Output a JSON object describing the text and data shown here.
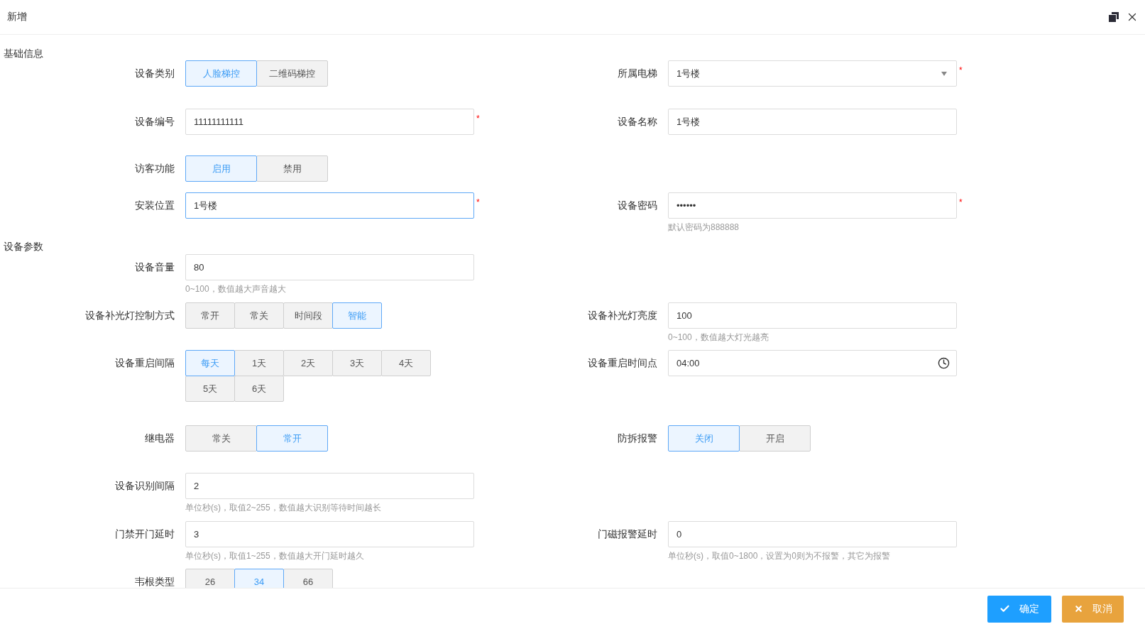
{
  "dialog": {
    "title": "新增"
  },
  "sections": [
    {
      "title": "基础信息",
      "rows": [
        {
          "left": {
            "label": "设备类别",
            "kind": "segmented",
            "options": [
              {
                "label": "人脸梯控",
                "selected": true
              },
              {
                "label": "二维码梯控",
                "selected": false
              }
            ]
          },
          "right": {
            "label": "所属电梯",
            "kind": "select",
            "value": "1号楼",
            "focused": false,
            "required_mark": "*"
          }
        },
        {
          "left": {
            "label": "设备编号",
            "kind": "input",
            "value": "11111111111",
            "focused": false,
            "required_mark": "*"
          },
          "right": {
            "label": "设备名称",
            "kind": "input",
            "value": "1号楼",
            "focused": false
          }
        },
        {
          "left": {
            "label": "访客功能",
            "kind": "segmented",
            "options": [
              {
                "label": "启用",
                "selected": true
              },
              {
                "label": "禁用",
                "selected": false
              }
            ]
          }
        },
        {
          "left": {
            "label": "安装位置",
            "kind": "input",
            "value": "1号楼",
            "focused": true,
            "required_mark": "*"
          },
          "right": {
            "label": "设备密码",
            "kind": "input",
            "value": "••••••",
            "focused": false,
            "required_mark": "*",
            "hint": "默认密码为888888"
          }
        }
      ]
    },
    {
      "title": "设备参数",
      "rows": [
        {
          "left": {
            "label": "设备音量",
            "kind": "input",
            "value": "80",
            "focused": false,
            "hint": "0~100，数值越大声音越大"
          }
        },
        {
          "left": {
            "label": "设备补光灯控制方式",
            "kind": "segmented",
            "options": [
              {
                "label": "常开",
                "selected": false
              },
              {
                "label": "常关",
                "selected": false
              },
              {
                "label": "时间段",
                "selected": false
              },
              {
                "label": "智能",
                "selected": true
              }
            ]
          },
          "right": {
            "label": "设备补光灯亮度",
            "kind": "input",
            "value": "100",
            "focused": false,
            "hint": "0~100，数值越大灯光越亮"
          }
        },
        {
          "left": {
            "label": "设备重启间隔",
            "kind": "segmented",
            "options": [
              {
                "label": "每天",
                "selected": true
              },
              {
                "label": "1天",
                "selected": false
              },
              {
                "label": "2天",
                "selected": false
              },
              {
                "label": "3天",
                "selected": false
              },
              {
                "label": "4天",
                "selected": false
              },
              {
                "label": "5天",
                "selected": false
              },
              {
                "label": "6天",
                "selected": false
              }
            ]
          },
          "right": {
            "label": "设备重启时间点",
            "kind": "time",
            "value": "04:00",
            "focused": false
          }
        },
        {
          "left": {
            "label": "继电器",
            "kind": "segmented",
            "options": [
              {
                "label": "常关",
                "selected": false
              },
              {
                "label": "常开",
                "selected": true
              }
            ]
          },
          "right": {
            "label": "防拆报警",
            "kind": "segmented",
            "options": [
              {
                "label": "关闭",
                "selected": true
              },
              {
                "label": "开启",
                "selected": false
              }
            ]
          }
        },
        {
          "left": {
            "label": "设备识别间隔",
            "kind": "input",
            "value": "2",
            "focused": false,
            "hint": "单位秒(s)，取值2~255，数值越大识别等待时间越长"
          }
        },
        {
          "left": {
            "label": "门禁开门延时",
            "kind": "input",
            "value": "3",
            "focused": false,
            "hint": "单位秒(s)，取值1~255，数值越大开门延时越久"
          },
          "right": {
            "label": "门磁报警延时",
            "kind": "input",
            "value": "0",
            "focused": false,
            "hint": "单位秒(s)，取值0~1800，设置为0则为不报警，其它为报警"
          }
        },
        {
          "left": {
            "label": "韦根类型",
            "kind": "segmented",
            "options": [
              {
                "label": "26",
                "selected": false
              },
              {
                "label": "34",
                "selected": true
              },
              {
                "label": "66",
                "selected": false
              }
            ]
          }
        }
      ]
    }
  ],
  "footer": {
    "buttons": [
      {
        "label": "确定",
        "kind": "confirm"
      },
      {
        "label": "取消",
        "kind": "cancel"
      }
    ]
  }
}
